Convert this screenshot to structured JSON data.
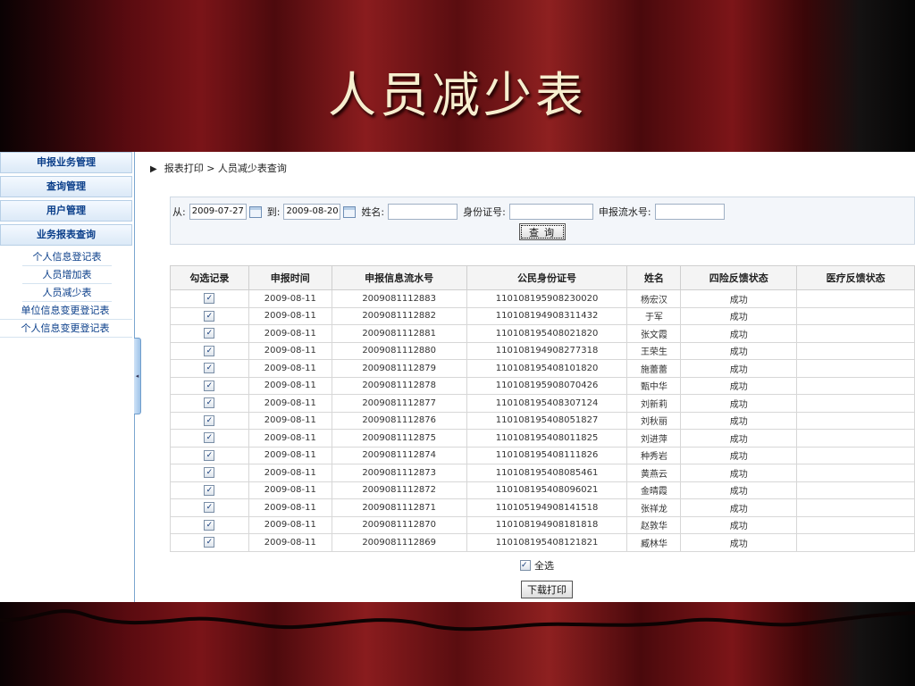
{
  "slide_title": "人员减少表",
  "sidebar": {
    "categories": [
      "申报业务管理",
      "查询管理",
      "用户管理",
      "业务报表查询"
    ],
    "subitems": [
      "个人信息登记表",
      "人员增加表",
      "人员减少表",
      "单位信息变更登记表",
      "个人信息变更登记表"
    ]
  },
  "breadcrumb": {
    "arrow": "▶",
    "text": "报表打印 > 人员减少表查询"
  },
  "filter": {
    "from_label": "从:",
    "from_value": "2009-07-27",
    "to_label": "到:",
    "to_value": "2009-08-20",
    "name_label": "姓名:",
    "name_value": "",
    "id_label": "身份证号:",
    "id_value": "",
    "serial_label": "申报流水号:",
    "serial_value": "",
    "query_button": "查询"
  },
  "table": {
    "columns": [
      "勾选记录",
      "申报时间",
      "申报信息流水号",
      "公民身份证号",
      "姓名",
      "四险反馈状态",
      "医疗反馈状态"
    ],
    "rows": [
      {
        "checked": true,
        "date": "2009-08-11",
        "serial": "2009081112883",
        "id": "110108195908230020",
        "name": "杨宏汉",
        "status4": "成功",
        "medical": ""
      },
      {
        "checked": true,
        "date": "2009-08-11",
        "serial": "2009081112882",
        "id": "110108194908311432",
        "name": "于军",
        "status4": "成功",
        "medical": ""
      },
      {
        "checked": true,
        "date": "2009-08-11",
        "serial": "2009081112881",
        "id": "110108195408021820",
        "name": "张文霞",
        "status4": "成功",
        "medical": ""
      },
      {
        "checked": true,
        "date": "2009-08-11",
        "serial": "2009081112880",
        "id": "110108194908277318",
        "name": "王荣生",
        "status4": "成功",
        "medical": ""
      },
      {
        "checked": true,
        "date": "2009-08-11",
        "serial": "2009081112879",
        "id": "110108195408101820",
        "name": "施蕾蕾",
        "status4": "成功",
        "medical": ""
      },
      {
        "checked": true,
        "date": "2009-08-11",
        "serial": "2009081112878",
        "id": "110108195908070426",
        "name": "甄中华",
        "status4": "成功",
        "medical": ""
      },
      {
        "checked": true,
        "date": "2009-08-11",
        "serial": "2009081112877",
        "id": "110108195408307124",
        "name": "刘新莉",
        "status4": "成功",
        "medical": ""
      },
      {
        "checked": true,
        "date": "2009-08-11",
        "serial": "2009081112876",
        "id": "110108195408051827",
        "name": "刘秋丽",
        "status4": "成功",
        "medical": ""
      },
      {
        "checked": true,
        "date": "2009-08-11",
        "serial": "2009081112875",
        "id": "110108195408011825",
        "name": "刘进萍",
        "status4": "成功",
        "medical": ""
      },
      {
        "checked": true,
        "date": "2009-08-11",
        "serial": "2009081112874",
        "id": "110108195408111826",
        "name": "种秀岩",
        "status4": "成功",
        "medical": ""
      },
      {
        "checked": true,
        "date": "2009-08-11",
        "serial": "2009081112873",
        "id": "110108195408085461",
        "name": "黄燕云",
        "status4": "成功",
        "medical": ""
      },
      {
        "checked": true,
        "date": "2009-08-11",
        "serial": "2009081112872",
        "id": "110108195408096021",
        "name": "金晴霞",
        "status4": "成功",
        "medical": ""
      },
      {
        "checked": true,
        "date": "2009-08-11",
        "serial": "2009081112871",
        "id": "110105194908141518",
        "name": "张祥龙",
        "status4": "成功",
        "medical": ""
      },
      {
        "checked": true,
        "date": "2009-08-11",
        "serial": "2009081112870",
        "id": "110108194908181818",
        "name": "赵敦华",
        "status4": "成功",
        "medical": ""
      },
      {
        "checked": true,
        "date": "2009-08-11",
        "serial": "2009081112869",
        "id": "110108195408121821",
        "name": "臧林华",
        "status4": "成功",
        "medical": ""
      }
    ]
  },
  "select_all": {
    "checked": true,
    "label": "全选"
  },
  "download_button": "下载打印",
  "colors": {
    "nav_text": "#0b3f8a",
    "curtain_red": "#7a1418",
    "title_text": "#f6eecf"
  }
}
